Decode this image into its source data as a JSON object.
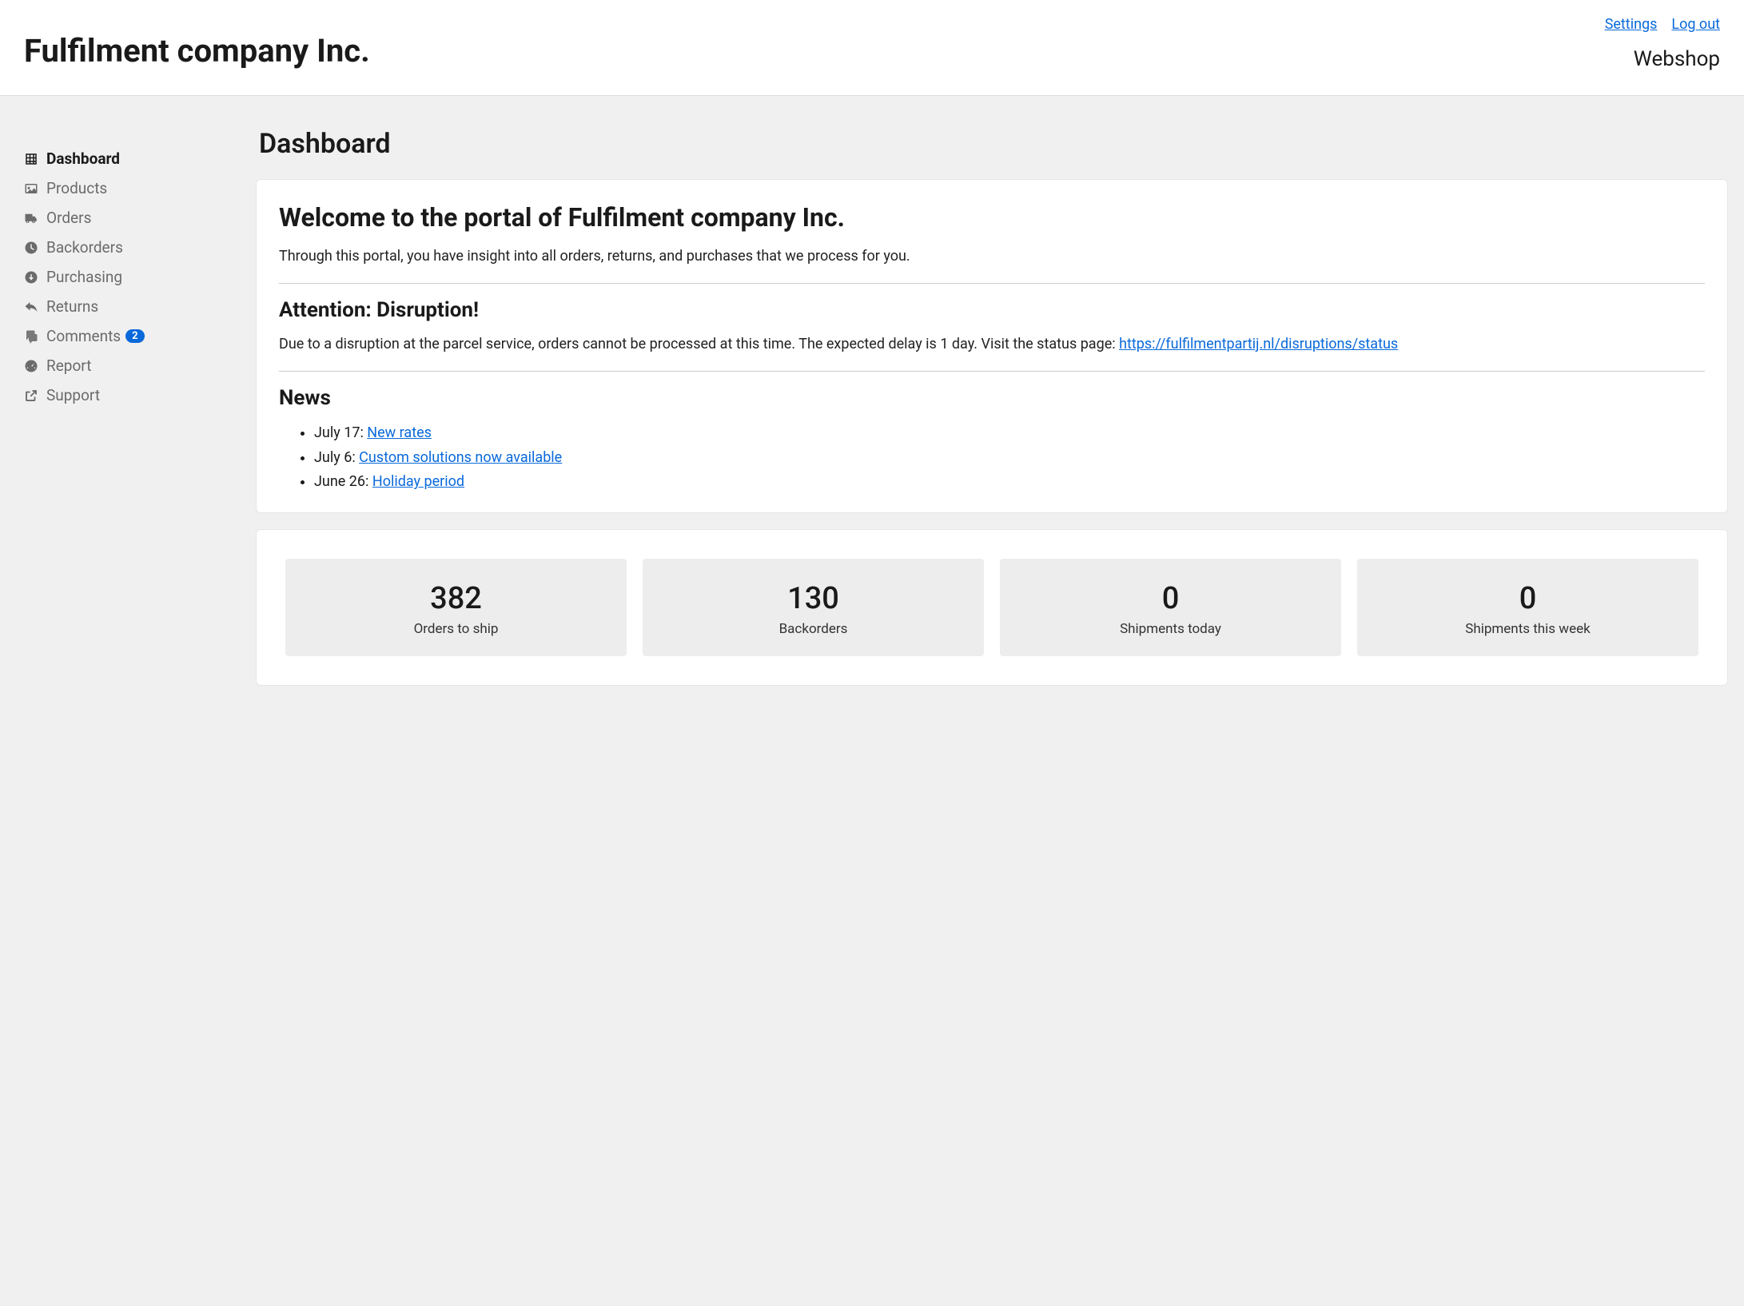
{
  "header": {
    "company": "Fulfilment company Inc.",
    "links": {
      "settings": "Settings",
      "logout": "Log out"
    },
    "context": "Webshop"
  },
  "sidebar": {
    "items": [
      {
        "label": "Dashboard",
        "icon": "grid-icon",
        "active": true
      },
      {
        "label": "Products",
        "icon": "image-icon"
      },
      {
        "label": "Orders",
        "icon": "truck-icon"
      },
      {
        "label": "Backorders",
        "icon": "clock-icon"
      },
      {
        "label": "Purchasing",
        "icon": "download-circle-icon"
      },
      {
        "label": "Returns",
        "icon": "reply-icon"
      },
      {
        "label": "Comments",
        "icon": "comments-icon",
        "badge": "2"
      },
      {
        "label": "Report",
        "icon": "gauge-icon"
      },
      {
        "label": "Support",
        "icon": "external-link-icon"
      }
    ]
  },
  "page": {
    "title": "Dashboard",
    "welcome_heading": "Welcome to the portal of Fulfilment company Inc.",
    "welcome_body": "Through this portal, you have insight into all orders, returns, and purchases that we process for you.",
    "alert_heading": "Attention: Disruption!",
    "alert_body_prefix": "Due to a disruption at the parcel service, orders cannot be processed at this time. The expected delay is 1 day. Visit the status page: ",
    "alert_link": "https://fulfilmentpartij.nl/disruptions/status",
    "news_heading": "News",
    "news": [
      {
        "date": "July 17",
        "title": "New rates"
      },
      {
        "date": "July 6",
        "title": "Custom solutions now available"
      },
      {
        "date": "June 26",
        "title": "Holiday period"
      }
    ],
    "stats": [
      {
        "value": "382",
        "label": "Orders to ship"
      },
      {
        "value": "130",
        "label": "Backorders"
      },
      {
        "value": "0",
        "label": "Shipments today"
      },
      {
        "value": "0",
        "label": "Shipments this week"
      }
    ]
  }
}
